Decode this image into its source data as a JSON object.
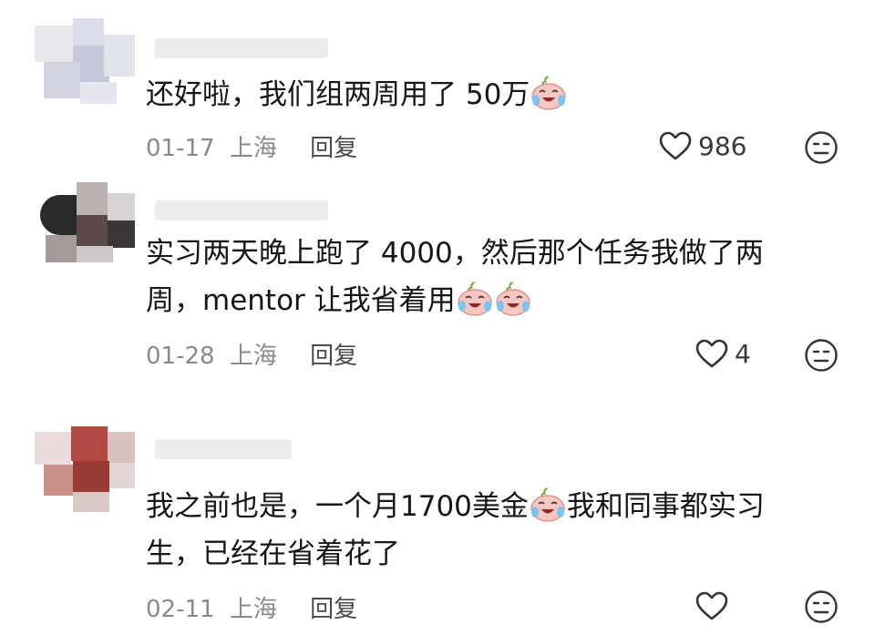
{
  "comments": [
    {
      "text_before": "还好啦，我们组两周用了 50万",
      "line2": "",
      "date": "01-17",
      "location": "上海",
      "reply_label": "回复",
      "likes": "986"
    },
    {
      "text_before": "实习两天晚上跑了 4000，然后那个任务我做了两",
      "line2": "周，mentor 让我省着用",
      "date": "01-28",
      "location": "上海",
      "reply_label": "回复",
      "likes": "4"
    },
    {
      "text_before": "我之前也是，一个月1700美金",
      "text_after": "我和同事都实习",
      "line2": "生，已经在省着花了",
      "date": "02-11",
      "location": "上海",
      "reply_label": "回复",
      "likes": ""
    }
  ],
  "icons": {
    "like": "heart-outline-icon",
    "dislike": "dislike-face-icon",
    "emoji": "crying-laughing-peach-emoji"
  },
  "colors": {
    "text": "#161616",
    "meta": "#8a8a8a",
    "icon": "#333333"
  }
}
